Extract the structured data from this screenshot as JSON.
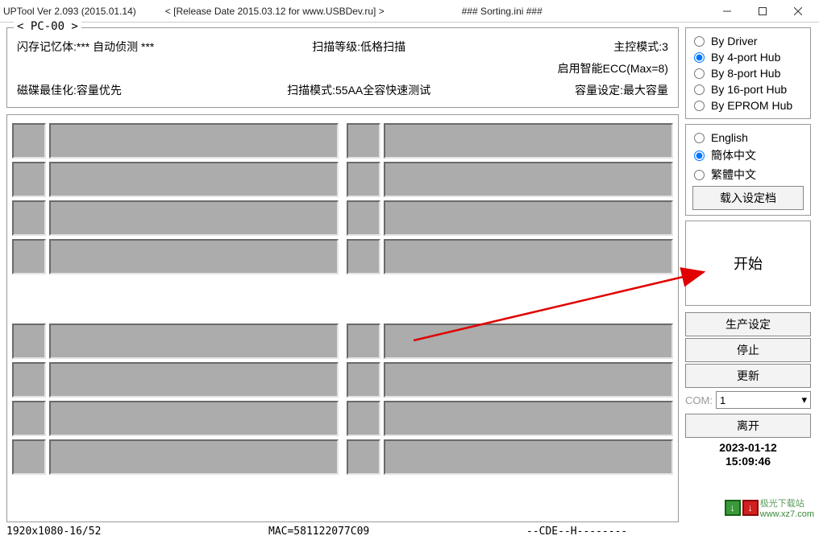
{
  "title": {
    "app": "UPTool Ver 2.093 (2015.01.14)",
    "release": "< [Release Date 2015.03.12 for www.USBDev.ru] >",
    "sorting": "### Sorting.ini ###"
  },
  "pc": {
    "title": "< PC-00 >",
    "row1": {
      "left": "闪存记忆体:*** 自动侦测 ***",
      "mid": "扫描等级:低格扫描",
      "right": "主控模式:3"
    },
    "row2": {
      "left": "",
      "mid": "",
      "right": "启用智能ECC(Max=8)"
    },
    "row3": {
      "left": "磁碟最佳化:容量优先",
      "mid": "扫描模式:55AA全容快速测试",
      "right": "容量设定:最大容量"
    }
  },
  "hub": {
    "options": [
      "By Driver",
      "By 4-port Hub",
      "By 8-port Hub",
      "By 16-port Hub",
      "By EPROM Hub"
    ],
    "selected": "By 4-port Hub"
  },
  "lang": {
    "options": [
      "English",
      "簡体中文",
      "繁體中文"
    ],
    "selected": "簡体中文",
    "load_btn": "载入设定档"
  },
  "buttons": {
    "start": "开始",
    "prod": "生产设定",
    "stop": "停止",
    "refresh": "更新",
    "leave": "离开"
  },
  "com": {
    "label": "COM:",
    "value": "1"
  },
  "datetime": {
    "date": "2023-01-12",
    "time": "15:09:46"
  },
  "status": {
    "res": "1920x1080-16/52",
    "mac": "MAC=581122077C09",
    "cde": "--CDE--H--------"
  },
  "watermark": {
    "brand": "极光下载站",
    "url": "www.xz7.com"
  }
}
